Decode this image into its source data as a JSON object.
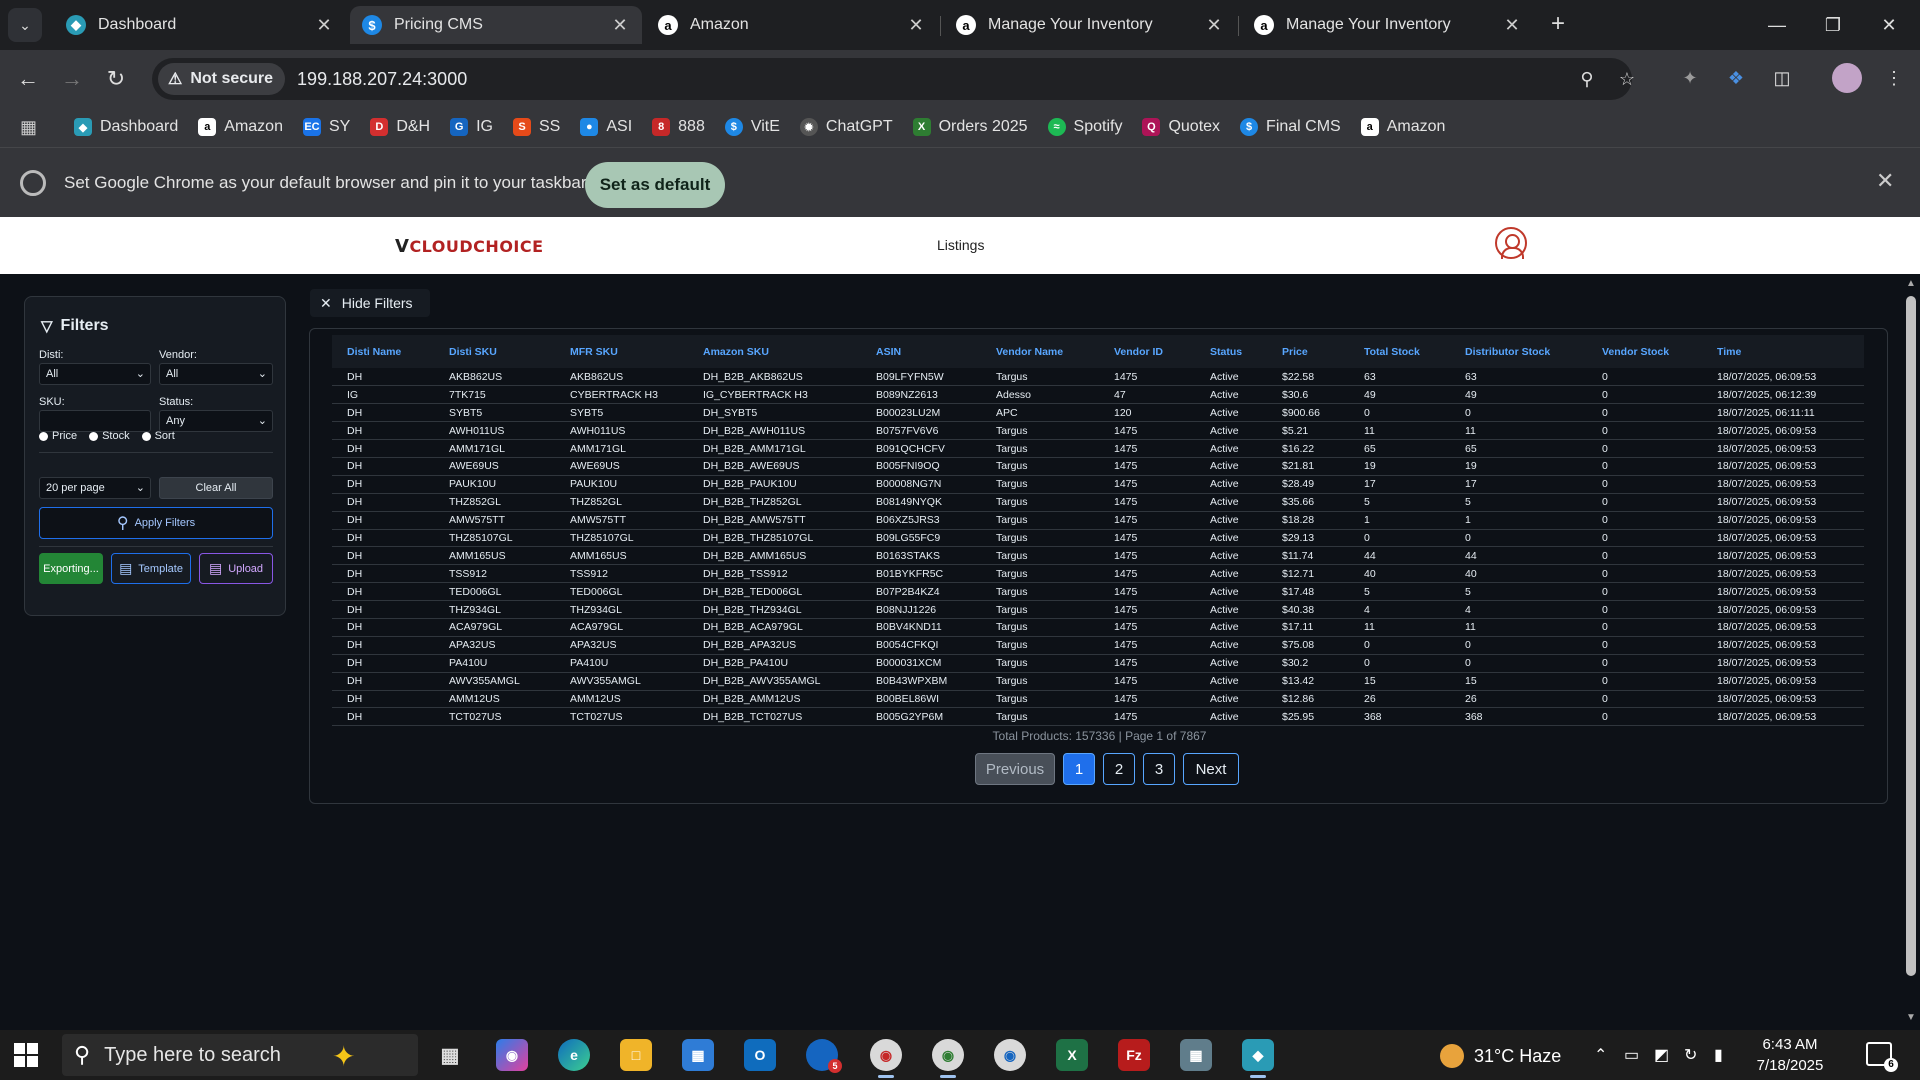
{
  "browser": {
    "tabs": [
      {
        "title": "Dashboard",
        "icon": "cms-blue-icon",
        "active": false
      },
      {
        "title": "Pricing CMS",
        "icon": "dollar-icon",
        "active": true
      },
      {
        "title": "Amazon",
        "icon": "amazon-icon",
        "active": false
      },
      {
        "title": "Manage Your Inventory",
        "icon": "amazon-icon",
        "active": false
      },
      {
        "title": "Manage Your Inventory",
        "icon": "amazon-icon",
        "active": false
      }
    ],
    "security_label": "Not secure",
    "url": "199.188.207.24:3000",
    "bookmarks": [
      {
        "label": "Dashboard",
        "color": "#2a9bb5"
      },
      {
        "label": "Amazon",
        "color": "#000000"
      },
      {
        "label": "SY",
        "color": "#1a73e8"
      },
      {
        "label": "D&H",
        "color": "#d32f2f"
      },
      {
        "label": "IG",
        "color": "#1565c0"
      },
      {
        "label": "SS",
        "color": "#e64a19"
      },
      {
        "label": "ASI",
        "color": "#1e88e5"
      },
      {
        "label": "888",
        "color": "#c62828"
      },
      {
        "label": "VitE",
        "color": "#1e88e5"
      },
      {
        "label": "ChatGPT",
        "color": "#555555"
      },
      {
        "label": "Orders 2025",
        "color": "#2e7d32"
      },
      {
        "label": "Spotify",
        "color": "#1db954"
      },
      {
        "label": "Quotex",
        "color": "#ad1457"
      },
      {
        "label": "Final CMS",
        "color": "#1e88e5"
      },
      {
        "label": "Amazon",
        "color": "#000000"
      }
    ],
    "banner": {
      "text": "Set Google Chrome as your default browser and pin it to your taskbar",
      "button": "Set as default"
    }
  },
  "app": {
    "logo": "CLOUDCHOICE",
    "logo_mark": "V",
    "nav_listings": "Listings"
  },
  "filters": {
    "title": "Filters",
    "disti_label": "Disti:",
    "disti_value": "All",
    "vendor_label": "Vendor:",
    "vendor_value": "All",
    "sku_label": "SKU:",
    "sku_value": "",
    "status_label": "Status:",
    "status_value": "Any",
    "radio_price": "Price",
    "radio_stock": "Stock",
    "radio_sort": "Sort",
    "per_page": "20 per page",
    "clear_all": "Clear All",
    "apply": "Apply Filters",
    "export": "Exporting...",
    "template": "Template",
    "upload": "Upload"
  },
  "hide_filters": "Hide Filters",
  "table": {
    "columns": [
      "Disti Name",
      "Disti SKU",
      "MFR SKU",
      "Amazon SKU",
      "ASIN",
      "Vendor Name",
      "Vendor ID",
      "Status",
      "Price",
      "Total Stock",
      "Distributor Stock",
      "Vendor Stock",
      "Time"
    ],
    "rows": [
      [
        "DH",
        "AKB862US",
        "AKB862US",
        "DH_B2B_AKB862US",
        "B09LFYFN5W",
        "Targus",
        "1475",
        "Active",
        "$22.58",
        "63",
        "63",
        "0",
        "18/07/2025, 06:09:53"
      ],
      [
        "IG",
        "7TK715",
        "CYBERTRACK H3",
        "IG_CYBERTRACK H3",
        "B089NZ2613",
        "Adesso",
        "47",
        "Active",
        "$30.6",
        "49",
        "49",
        "0",
        "18/07/2025, 06:12:39"
      ],
      [
        "DH",
        "SYBT5",
        "SYBT5",
        "DH_SYBT5",
        "B00023LU2M",
        "APC",
        "120",
        "Active",
        "$900.66",
        "0",
        "0",
        "0",
        "18/07/2025, 06:11:11"
      ],
      [
        "DH",
        "AWH011US",
        "AWH011US",
        "DH_B2B_AWH011US",
        "B0757FV6V6",
        "Targus",
        "1475",
        "Active",
        "$5.21",
        "11",
        "11",
        "0",
        "18/07/2025, 06:09:53"
      ],
      [
        "DH",
        "AMM171GL",
        "AMM171GL",
        "DH_B2B_AMM171GL",
        "B091QCHCFV",
        "Targus",
        "1475",
        "Active",
        "$16.22",
        "65",
        "65",
        "0",
        "18/07/2025, 06:09:53"
      ],
      [
        "DH",
        "AWE69US",
        "AWE69US",
        "DH_B2B_AWE69US",
        "B005FNI9OQ",
        "Targus",
        "1475",
        "Active",
        "$21.81",
        "19",
        "19",
        "0",
        "18/07/2025, 06:09:53"
      ],
      [
        "DH",
        "PAUK10U",
        "PAUK10U",
        "DH_B2B_PAUK10U",
        "B00008NG7N",
        "Targus",
        "1475",
        "Active",
        "$28.49",
        "17",
        "17",
        "0",
        "18/07/2025, 06:09:53"
      ],
      [
        "DH",
        "THZ852GL",
        "THZ852GL",
        "DH_B2B_THZ852GL",
        "B08149NYQK",
        "Targus",
        "1475",
        "Active",
        "$35.66",
        "5",
        "5",
        "0",
        "18/07/2025, 06:09:53"
      ],
      [
        "DH",
        "AMW575TT",
        "AMW575TT",
        "DH_B2B_AMW575TT",
        "B06XZ5JRS3",
        "Targus",
        "1475",
        "Active",
        "$18.28",
        "1",
        "1",
        "0",
        "18/07/2025, 06:09:53"
      ],
      [
        "DH",
        "THZ85107GL",
        "THZ85107GL",
        "DH_B2B_THZ85107GL",
        "B09LG55FC9",
        "Targus",
        "1475",
        "Active",
        "$29.13",
        "0",
        "0",
        "0",
        "18/07/2025, 06:09:53"
      ],
      [
        "DH",
        "AMM165US",
        "AMM165US",
        "DH_B2B_AMM165US",
        "B0163STAKS",
        "Targus",
        "1475",
        "Active",
        "$11.74",
        "44",
        "44",
        "0",
        "18/07/2025, 06:09:53"
      ],
      [
        "DH",
        "TSS912",
        "TSS912",
        "DH_B2B_TSS912",
        "B01BYKFR5C",
        "Targus",
        "1475",
        "Active",
        "$12.71",
        "40",
        "40",
        "0",
        "18/07/2025, 06:09:53"
      ],
      [
        "DH",
        "TED006GL",
        "TED006GL",
        "DH_B2B_TED006GL",
        "B07P2B4KZ4",
        "Targus",
        "1475",
        "Active",
        "$17.48",
        "5",
        "5",
        "0",
        "18/07/2025, 06:09:53"
      ],
      [
        "DH",
        "THZ934GL",
        "THZ934GL",
        "DH_B2B_THZ934GL",
        "B08NJJ1226",
        "Targus",
        "1475",
        "Active",
        "$40.38",
        "4",
        "4",
        "0",
        "18/07/2025, 06:09:53"
      ],
      [
        "DH",
        "ACA979GL",
        "ACA979GL",
        "DH_B2B_ACA979GL",
        "B0BV4KND11",
        "Targus",
        "1475",
        "Active",
        "$17.11",
        "11",
        "11",
        "0",
        "18/07/2025, 06:09:53"
      ],
      [
        "DH",
        "APA32US",
        "APA32US",
        "DH_B2B_APA32US",
        "B0054CFKQI",
        "Targus",
        "1475",
        "Active",
        "$75.08",
        "0",
        "0",
        "0",
        "18/07/2025, 06:09:53"
      ],
      [
        "DH",
        "PA410U",
        "PA410U",
        "DH_B2B_PA410U",
        "B000031XCM",
        "Targus",
        "1475",
        "Active",
        "$30.2",
        "0",
        "0",
        "0",
        "18/07/2025, 06:09:53"
      ],
      [
        "DH",
        "AWV355AMGL",
        "AWV355AMGL",
        "DH_B2B_AWV355AMGL",
        "B0B43WPXBM",
        "Targus",
        "1475",
        "Active",
        "$13.42",
        "15",
        "15",
        "0",
        "18/07/2025, 06:09:53"
      ],
      [
        "DH",
        "AMM12US",
        "AMM12US",
        "DH_B2B_AMM12US",
        "B00BEL86WI",
        "Targus",
        "1475",
        "Active",
        "$12.86",
        "26",
        "26",
        "0",
        "18/07/2025, 06:09:53"
      ],
      [
        "DH",
        "TCT027US",
        "TCT027US",
        "DH_B2B_TCT027US",
        "B005G2YP6M",
        "Targus",
        "1475",
        "Active",
        "$25.95",
        "368",
        "368",
        "0",
        "18/07/2025, 06:09:53"
      ]
    ],
    "total_line": "Total Products: 157336 | Page 1 of 7867",
    "pagination": {
      "previous": "Previous",
      "pages": [
        "1",
        "2",
        "3"
      ],
      "current": "1",
      "next": "Next"
    }
  },
  "taskbar": {
    "search_placeholder": "Type here to search",
    "weather": "31°C  Haze",
    "time": "6:43 AM",
    "date": "7/18/2025",
    "notification_count": "6",
    "outlook_badge": "5"
  }
}
